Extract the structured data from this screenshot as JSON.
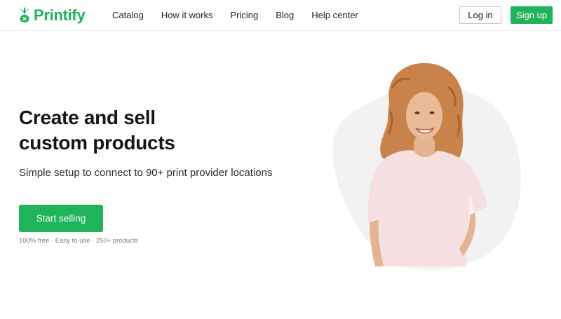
{
  "header": {
    "brand": "Printify",
    "nav": [
      "Catalog",
      "How it works",
      "Pricing",
      "Blog",
      "Help center"
    ],
    "login_label": "Log in",
    "signup_label": "Sign up"
  },
  "hero": {
    "title_line1": "Create and sell",
    "title_line2": "custom products",
    "subtitle": "Simple setup to connect to 90+ print provider locations",
    "cta_label": "Start selling",
    "features": "100% free · Easy to use · 250+ products",
    "image_alt": "Smiling woman with curly hair wearing a light pink t-shirt"
  },
  "colors": {
    "brand_green": "#1fb35a",
    "blob_gray": "#f2f2f2",
    "shirt_pink": "#f6dfe1"
  },
  "icons": {
    "logo": "printify-logo-icon"
  }
}
